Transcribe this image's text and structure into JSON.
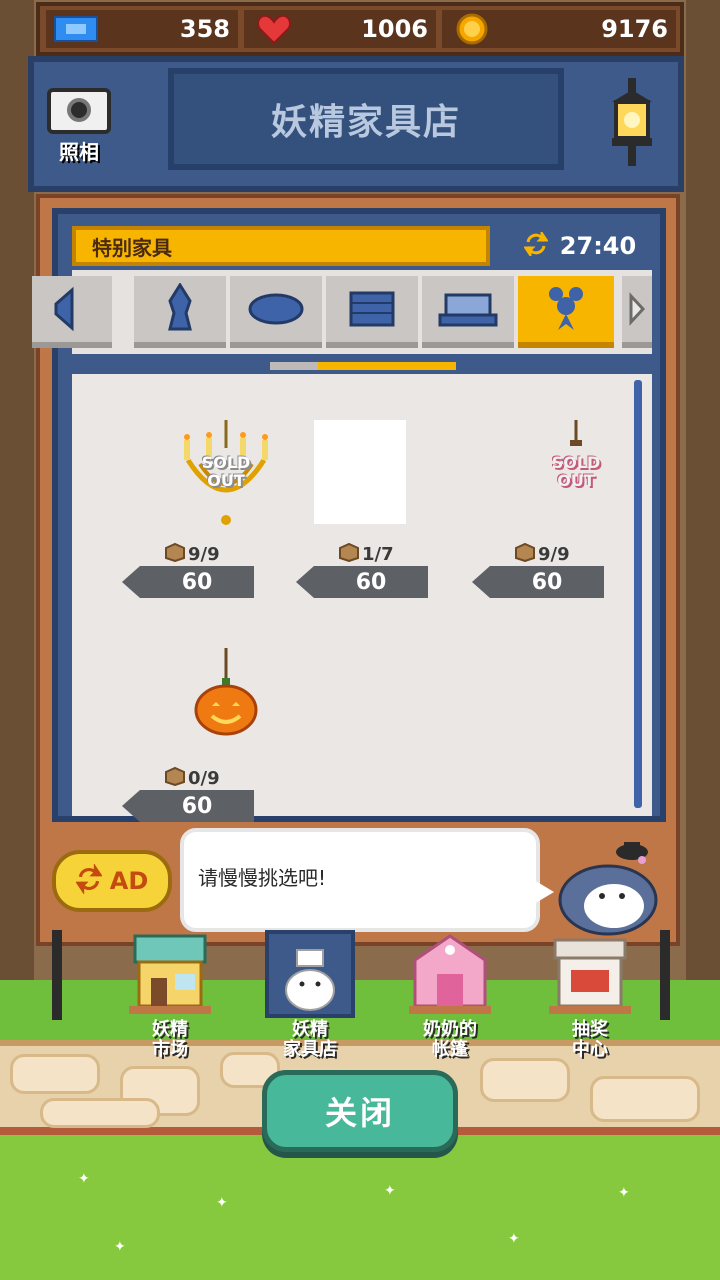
{
  "top_bar": {
    "tickets": "358",
    "hearts": "1006",
    "coins": "9176"
  },
  "header": {
    "title": "妖精家具店",
    "camera_label": "照相"
  },
  "shop": {
    "category_label": "特别家具",
    "timer": "27:40",
    "categories": [
      "speaker-icon",
      "vase-icon",
      "rug-icon",
      "cabinet-icon",
      "bed-icon",
      "ribbon-decor-icon"
    ],
    "active_category_index": 5,
    "items": [
      {
        "name": "chandelier",
        "stock": "9/9",
        "price": "60",
        "soldout_text": "SOLD\nOUT"
      },
      {
        "name": "blank-item",
        "stock": "1/7",
        "price": "60",
        "soldout_text": ""
      },
      {
        "name": "hanging-ornament",
        "stock": "9/9",
        "price": "60",
        "soldout_text": "SOLD\nOUT"
      },
      {
        "name": "pumpkin-lantern",
        "stock": "0/9",
        "price": "60",
        "soldout_text": ""
      }
    ]
  },
  "ad_button": {
    "label": "AD"
  },
  "speech": {
    "text": "请慢慢挑选吧!"
  },
  "nav": {
    "items": [
      {
        "label": "妖精\n市场"
      },
      {
        "label": "妖精\n家具店"
      },
      {
        "label": "奶奶的\n帐篷"
      },
      {
        "label": "抽奖\n中心"
      }
    ]
  },
  "close_button": {
    "label": "关闭"
  }
}
